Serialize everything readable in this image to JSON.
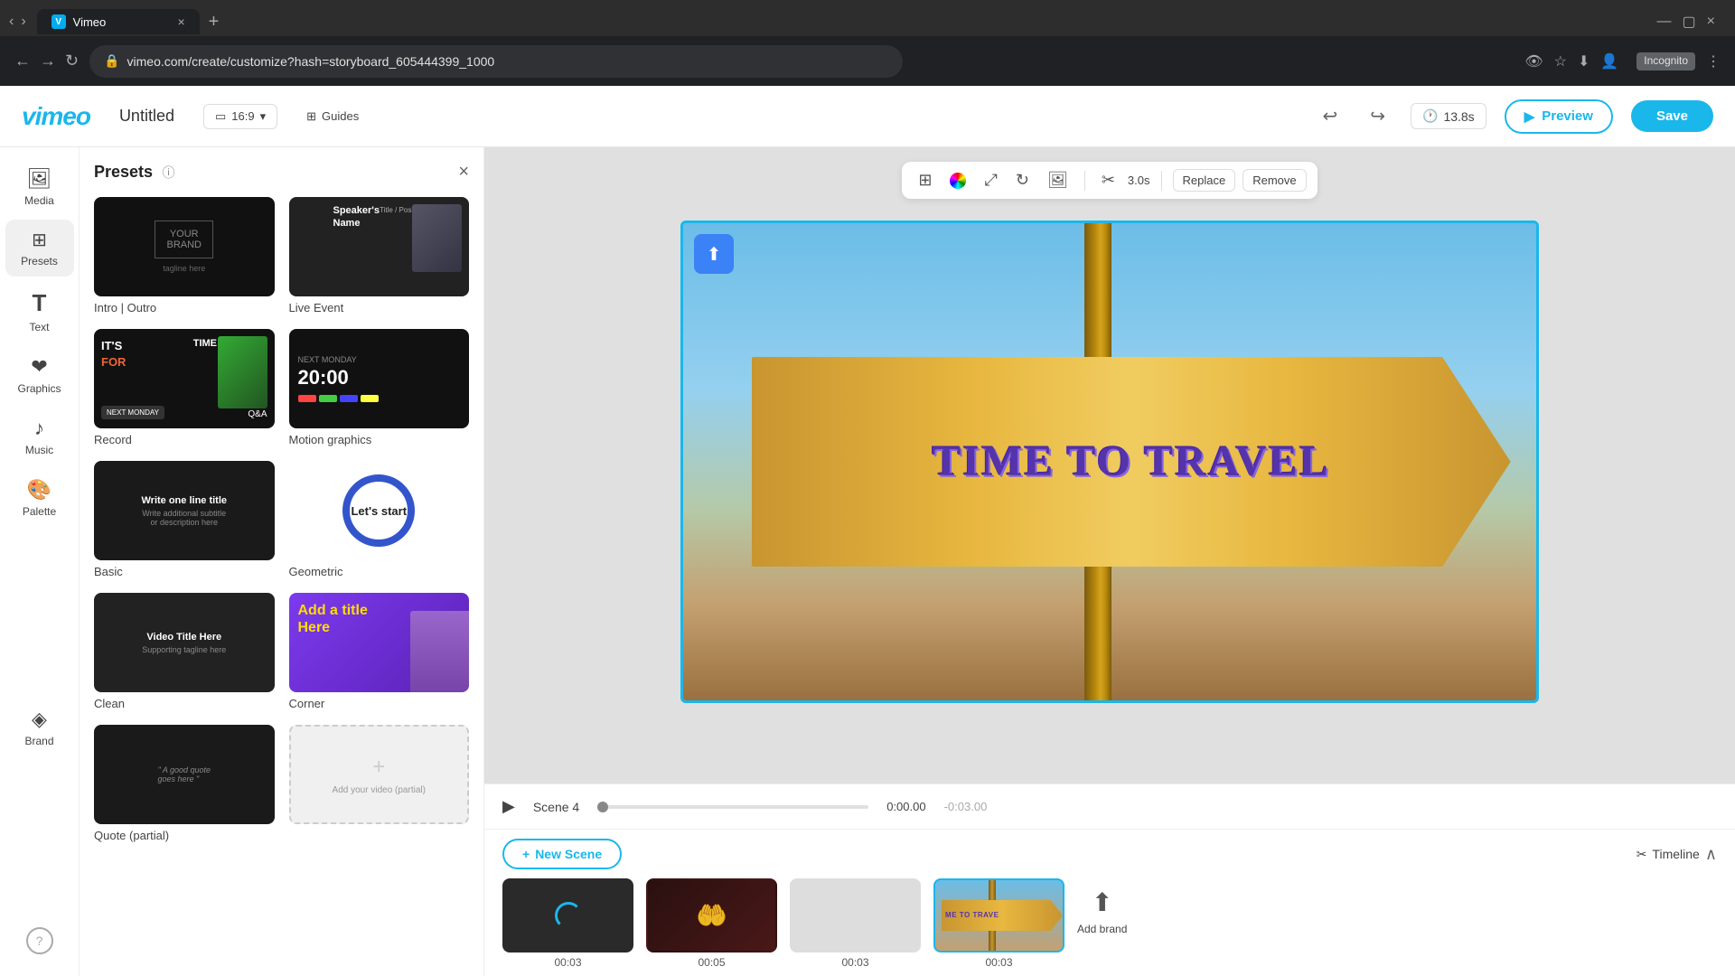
{
  "browser": {
    "url": "vimeo.com/create/customize?hash=storyboard_605444399_1000",
    "tab_title": "Vimeo",
    "window_controls": [
      "minimize",
      "maximize",
      "close"
    ],
    "incognito_label": "Incognito"
  },
  "toolbar": {
    "logo": "vimeo",
    "project_title": "Untitled",
    "aspect_ratio": "16:9",
    "guides_label": "Guides",
    "undo_label": "↩",
    "redo_label": "↪",
    "timer": "13.8s",
    "preview_label": "Preview",
    "save_label": "Save"
  },
  "sidebar": {
    "items": [
      {
        "id": "media",
        "label": "Media",
        "icon": "🖼"
      },
      {
        "id": "presets",
        "label": "Presets",
        "icon": "⊞"
      },
      {
        "id": "text",
        "label": "Text",
        "icon": "T"
      },
      {
        "id": "graphics",
        "label": "Graphics",
        "icon": "❤"
      },
      {
        "id": "music",
        "label": "Music",
        "icon": "♪"
      },
      {
        "id": "palette",
        "label": "Palette",
        "icon": "🎨"
      },
      {
        "id": "brand",
        "label": "Brand",
        "icon": "◈"
      }
    ],
    "help_label": "?"
  },
  "presets_panel": {
    "title": "Presets",
    "close_label": "×",
    "items": [
      {
        "id": "intro-outro",
        "label": "Intro | Outro"
      },
      {
        "id": "live-event",
        "label": "Live Event"
      },
      {
        "id": "record",
        "label": "Record"
      },
      {
        "id": "motion-graphics",
        "label": "Motion graphics"
      },
      {
        "id": "basic",
        "label": "Basic"
      },
      {
        "id": "geometric",
        "label": "Geometric"
      },
      {
        "id": "clean",
        "label": "Clean"
      },
      {
        "id": "corner",
        "label": "Corner"
      },
      {
        "id": "quote",
        "label": "Quote (partial)"
      },
      {
        "id": "add-video",
        "label": "Add your video (partial)"
      }
    ]
  },
  "canvas": {
    "main_text": "TIME TO TRAVEL",
    "upload_icon": "⬆",
    "tools": {
      "layout_icon": "⊞",
      "color_icon": "◉",
      "expand_icon": "⤢",
      "crop_icon": "↻",
      "image_icon": "🖼",
      "scissors_icon": "✂",
      "duration": "3.0s",
      "replace_label": "Replace",
      "remove_label": "Remove"
    }
  },
  "scene_bar": {
    "play_icon": "▶",
    "scene_label": "Scene 4",
    "current_time": "0:00.00",
    "total_time": "-0:03.00"
  },
  "bottom_bar": {
    "new_scene_label": "New Scene",
    "timeline_label": "Timeline",
    "collapse_icon": "∧",
    "scissors_icon": "✂",
    "scenes": [
      {
        "id": 1,
        "time": "00:03",
        "type": "dark"
      },
      {
        "id": 2,
        "time": "00:05",
        "type": "hearts"
      },
      {
        "id": 3,
        "time": "00:03",
        "type": "blank"
      },
      {
        "id": 4,
        "time": "00:03",
        "type": "travel",
        "active": true
      }
    ],
    "add_brand_label": "Add brand"
  },
  "corner_preset": {
    "title_text": "Add a title\nHere"
  }
}
